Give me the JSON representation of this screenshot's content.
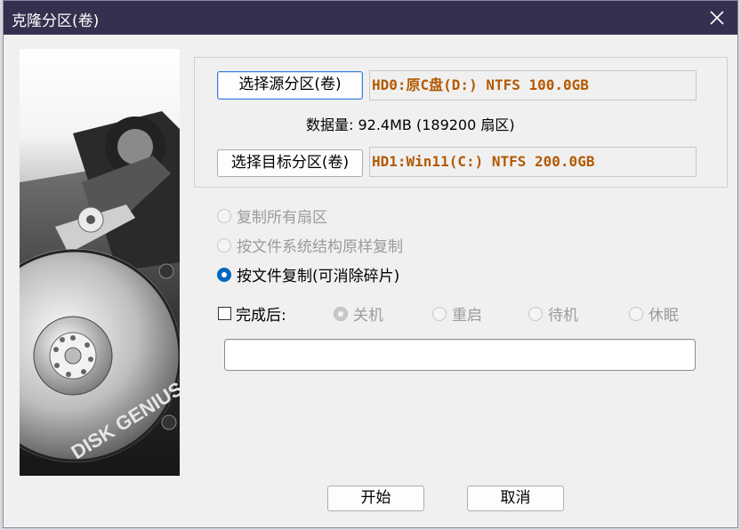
{
  "window": {
    "title": "克隆分区(卷)"
  },
  "source": {
    "button_label": "选择源分区(卷)",
    "value": "HD0:原C盘(D:) NTFS 100.0GB",
    "data_size": "数据量: 92.4MB (189200 扇区)"
  },
  "target": {
    "button_label": "选择目标分区(卷)",
    "value": "HD1:Win11(C:) NTFS 200.0GB"
  },
  "copy_modes": [
    {
      "label": "复制所有扇区",
      "checked": false,
      "enabled": false
    },
    {
      "label": "按文件系统结构原样复制",
      "checked": false,
      "enabled": false
    },
    {
      "label": "按文件复制(可消除碎片)",
      "checked": true,
      "enabled": true
    }
  ],
  "after_completion": {
    "label": "完成后:",
    "checked": false,
    "options": [
      "关机",
      "重启",
      "待机",
      "休眠"
    ],
    "selected": "关机"
  },
  "progress": {
    "value": 0
  },
  "buttons": {
    "start": "开始",
    "cancel": "取消"
  },
  "branding": {
    "logo_text": "DISK GENIUS"
  },
  "colors": {
    "titlebar": "#34304f",
    "value_text": "#b35a00",
    "radio_accent": "#0067c0"
  }
}
